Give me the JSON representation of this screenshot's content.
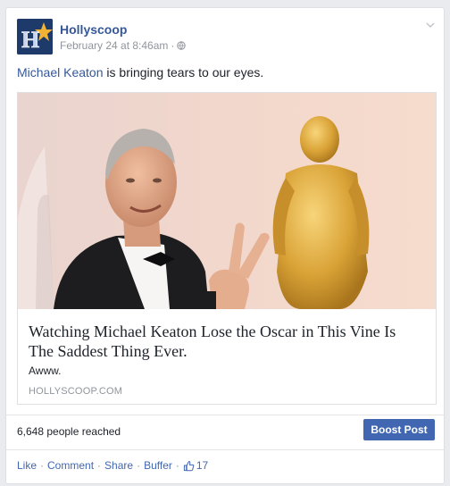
{
  "post": {
    "page_name": "Hollyscoop",
    "timestamp": "February 24 at 8:46am",
    "timestamp_sep": "·",
    "privacy_icon": "globe-icon",
    "text_link": "Michael Keaton",
    "text_rest": " is bringing tears to our eyes."
  },
  "attachment": {
    "title": "Watching Michael Keaton Lose the Oscar in This Vine Is The Saddest Thing Ever.",
    "description": "Awww.",
    "domain": "HOLLYSCOOP.COM"
  },
  "insights": {
    "reach": "6,648 people reached",
    "boost_label": "Boost Post"
  },
  "actions": {
    "like": "Like",
    "comment": "Comment",
    "share": "Share",
    "buffer": "Buffer",
    "sep": "·",
    "like_count": "17"
  },
  "colors": {
    "link": "#365899",
    "boost": "#4267b2",
    "meta": "#90949c"
  }
}
